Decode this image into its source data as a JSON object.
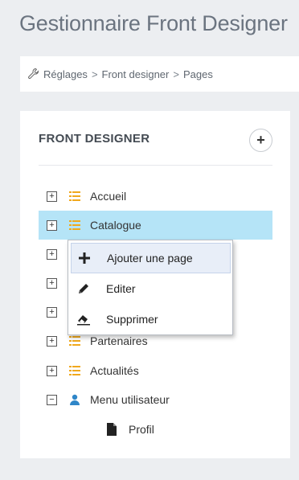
{
  "page": {
    "title": "Gestionnaire Front Designer"
  },
  "breadcrumb": {
    "items": [
      "Réglages",
      "Front designer",
      "Pages"
    ],
    "separator": ">"
  },
  "panel": {
    "title": "FRONT DESIGNER",
    "add_button": "+"
  },
  "tree": {
    "items": [
      {
        "label": "Accueil",
        "expander": "+",
        "icon": "list-icon"
      },
      {
        "label": "Catalogue",
        "expander": "+",
        "icon": "list-icon",
        "selected": true
      },
      {
        "label": "",
        "expander": "+",
        "icon": "list-icon"
      },
      {
        "label": "",
        "expander": "+",
        "icon": "list-icon"
      },
      {
        "label": "",
        "expander": "+",
        "icon": "list-icon"
      },
      {
        "label": "Partenaires",
        "expander": "+",
        "icon": "list-icon"
      },
      {
        "label": "Actualités",
        "expander": "+",
        "icon": "list-icon"
      },
      {
        "label": "Menu utilisateur",
        "expander": "−",
        "icon": "user-icon"
      },
      {
        "label": "Profil",
        "icon": "file-icon",
        "level": 1
      }
    ]
  },
  "context_menu": {
    "items": [
      {
        "label": "Ajouter une page",
        "icon": "plus-icon"
      },
      {
        "label": "Editer",
        "icon": "pencil-icon"
      },
      {
        "label": "Supprimer",
        "icon": "eraser-icon"
      }
    ]
  },
  "colors": {
    "selected_row": "#b5e4f7",
    "list_icon": "#f0a81c",
    "user_icon": "#2f86c8",
    "menu_hover": "#e8eef8"
  }
}
